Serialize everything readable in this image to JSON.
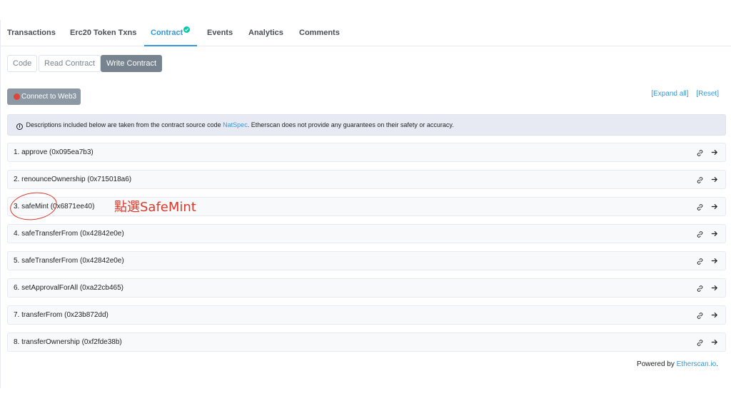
{
  "tabs": [
    {
      "label": "Transactions"
    },
    {
      "label": "Erc20 Token Txns"
    },
    {
      "label": "Contract"
    },
    {
      "label": "Events"
    },
    {
      "label": "Analytics"
    },
    {
      "label": "Comments"
    }
  ],
  "subtabs": [
    {
      "label": "Code"
    },
    {
      "label": "Read Contract"
    },
    {
      "label": "Write Contract"
    }
  ],
  "connect": {
    "label": "Connect to Web3"
  },
  "links": {
    "expand": "[Expand all]",
    "reset": "[Reset]"
  },
  "notice": {
    "icon": "i",
    "before": "Descriptions included below are taken from the contract source code ",
    "link": "NatSpec",
    "after": ". Etherscan does not provide any guarantees on their safety or accuracy."
  },
  "functions": [
    {
      "label": "1. approve (0x095ea7b3)"
    },
    {
      "label": "2. renounceOwnership (0x715018a6)"
    },
    {
      "label": "3. safeMint (0x6871ee40)"
    },
    {
      "label": "4. safeTransferFrom (0x42842e0e)"
    },
    {
      "label": "5. safeTransferFrom (0x42842e0e)"
    },
    {
      "label": "6. setApprovalForAll (0xa22cb465)"
    },
    {
      "label": "7. transferFrom (0x23b872dd)"
    },
    {
      "label": "8. transferOwnership (0xf2fde38b)"
    }
  ],
  "annotation": {
    "text": "點選SafeMint"
  },
  "footer": {
    "prefix": "Powered by ",
    "link": "Etherscan.io",
    "suffix": "."
  },
  "colors": {
    "accent": "#3498db",
    "success": "#00c9a7",
    "danger": "#de4437",
    "annotation": "#d93a2b"
  },
  "icons": {
    "verified": "check-circle-icon",
    "copy": "link-icon",
    "expand": "arrow-right-icon",
    "info": "info-icon"
  }
}
